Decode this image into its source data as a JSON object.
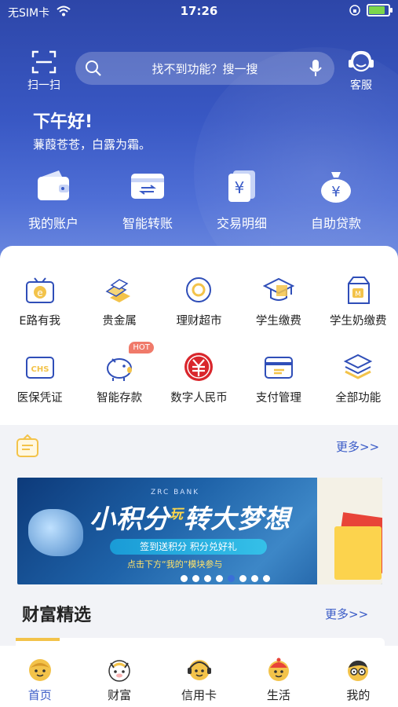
{
  "status_bar": {
    "carrier": "无SIM卡",
    "time": "17:26"
  },
  "header": {
    "scan_label": "扫一扫",
    "search_placeholder": "找不到功能？搜一搜",
    "service_label": "客服",
    "greeting": "下午好!",
    "poem": "蒹葭苍苍，白露为霜。"
  },
  "quick_actions": [
    {
      "label": "我的账户",
      "icon": "wallet-icon"
    },
    {
      "label": "智能转账",
      "icon": "transfer-card-icon"
    },
    {
      "label": "交易明细",
      "icon": "transaction-detail-icon"
    },
    {
      "label": "自助贷款",
      "icon": "money-bag-icon"
    }
  ],
  "functions": [
    {
      "label": "E路有我",
      "icon": "tv-e-icon"
    },
    {
      "label": "贵金属",
      "icon": "gold-bars-icon"
    },
    {
      "label": "理财超市",
      "icon": "coin-icon"
    },
    {
      "label": "学生缴费",
      "icon": "graduation-cap-icon"
    },
    {
      "label": "学生奶缴费",
      "icon": "milk-box-icon"
    },
    {
      "label": "医保凭证",
      "icon": "chs-card-icon"
    },
    {
      "label": "智能存款",
      "icon": "piggy-bank-icon",
      "badge": "HOT"
    },
    {
      "label": "数字人民币",
      "icon": "digital-rmb-icon"
    },
    {
      "label": "支付管理",
      "icon": "payment-card-icon"
    },
    {
      "label": "全部功能",
      "icon": "layers-icon"
    }
  ],
  "notice": {
    "more": "更多>>"
  },
  "banner": {
    "brand": "ZRC BANK",
    "title_a": "小积分",
    "title_play": "玩",
    "title_b": "转大梦想",
    "subtitle": "签到送积分 积分兑好礼",
    "tip": "点击下方“我的”模块参与",
    "active_slide": 5,
    "slide_count": 8
  },
  "wealth": {
    "title": "财富精选",
    "more": "更多>>"
  },
  "tabbar": [
    {
      "label": "首页",
      "icon": "home-face-icon",
      "active": true
    },
    {
      "label": "财富",
      "icon": "wealth-face-icon",
      "active": false
    },
    {
      "label": "信用卡",
      "icon": "credit-face-icon",
      "active": false
    },
    {
      "label": "生活",
      "icon": "life-face-icon",
      "active": false
    },
    {
      "label": "我的",
      "icon": "mine-face-icon",
      "active": false
    }
  ],
  "colors": {
    "primary": "#3a5bc7",
    "hero_top": "#2d46a8",
    "icon_blue": "#2f4eb8",
    "icon_yellow": "#f3c34a",
    "hot": "#f07a6a",
    "rmb_red": "#d9262c"
  }
}
